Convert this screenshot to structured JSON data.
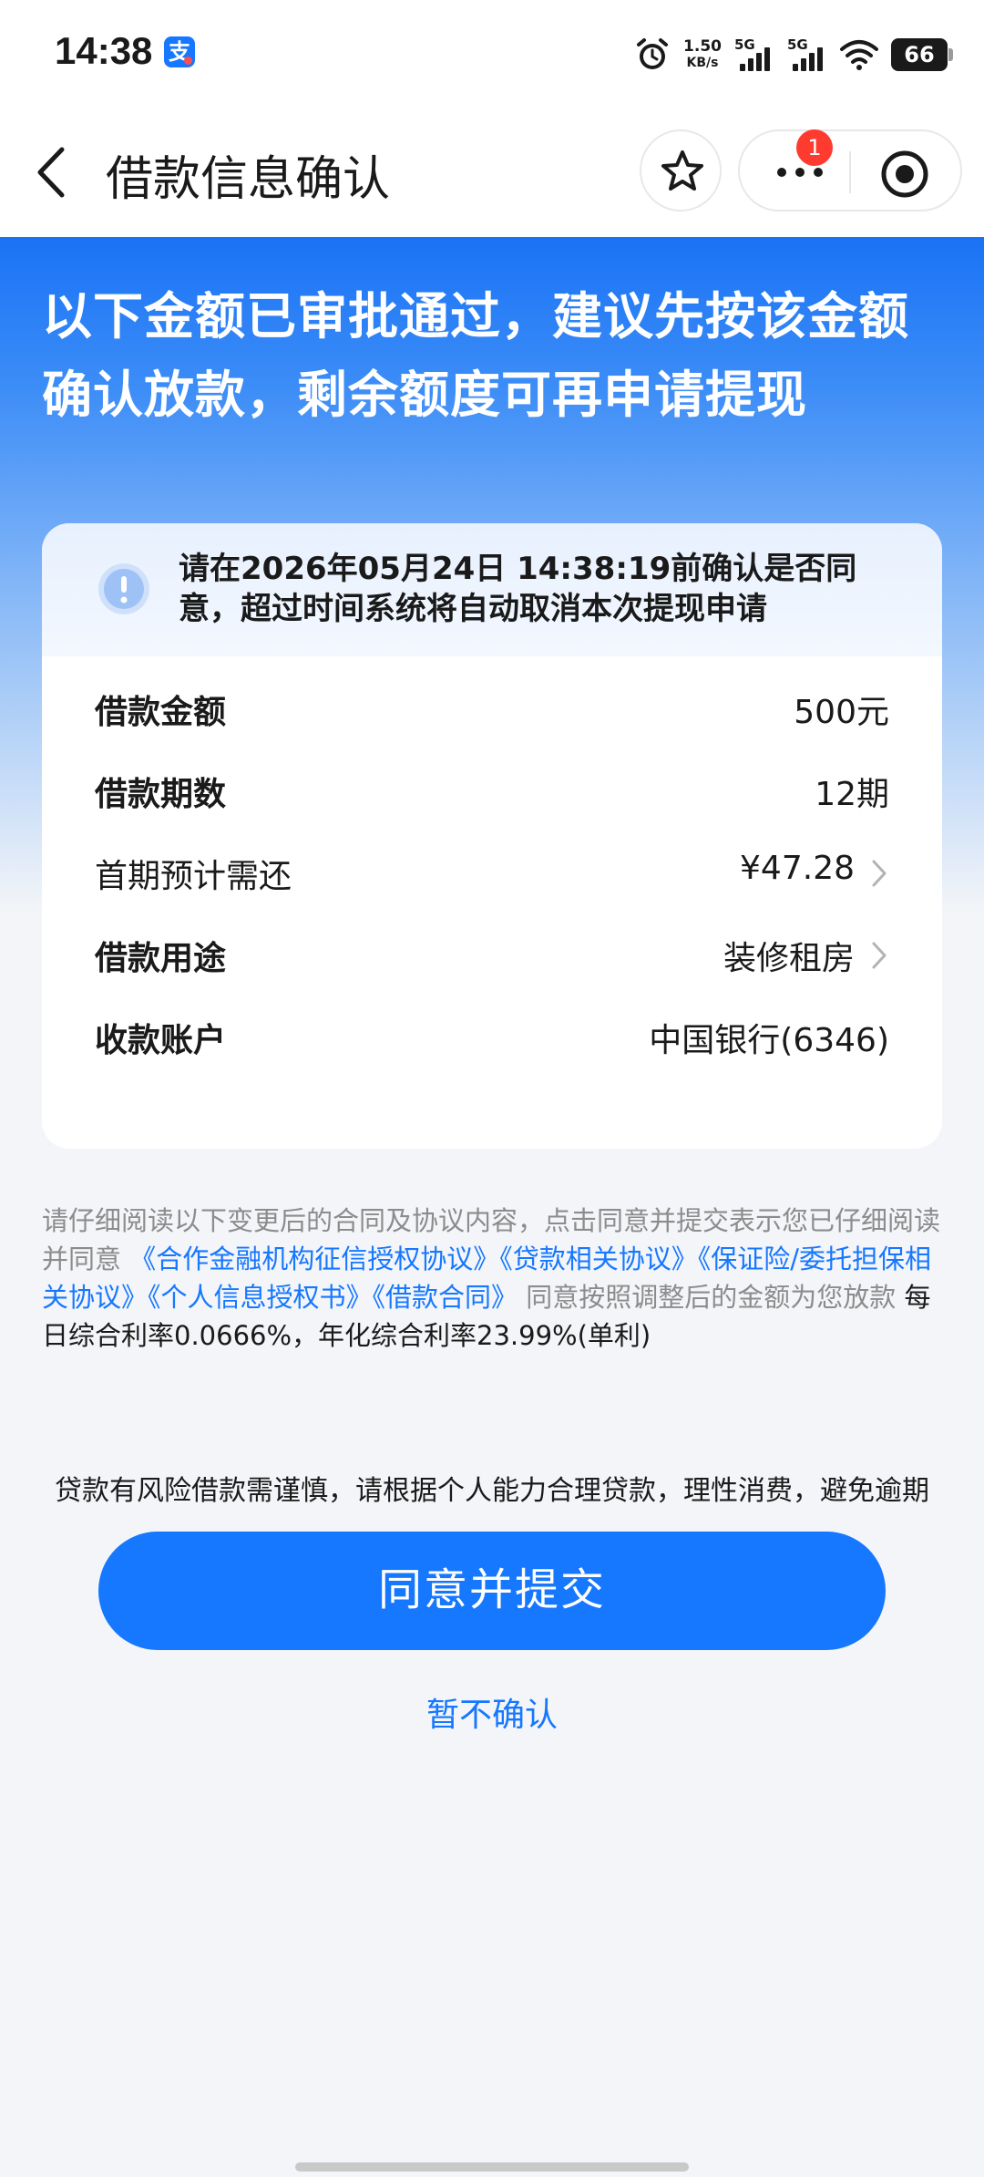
{
  "status_bar": {
    "time": "14:38",
    "app_badge": "支",
    "net_speed_value": "1.50",
    "net_speed_unit": "KB/s",
    "sim1": "5G",
    "sim2": "5G",
    "battery": "66"
  },
  "nav": {
    "title": "借款信息确认",
    "notification_count": "1"
  },
  "hero": {
    "title": "以下金额已审批通过，建议先按该金额确认放款，剩余额度可再申请提现"
  },
  "notice": {
    "text": "请在2026年05月24日 14:38:19前确认是否同意，超过时间系统将自动取消本次提现申请"
  },
  "loan_details": [
    {
      "label": "借款金额",
      "value": "500元"
    },
    {
      "label": "借款期数",
      "value": "12期"
    },
    {
      "label": "首期预计需还",
      "value": "¥47.28"
    },
    {
      "label": "借款用途",
      "value": "装修租房"
    },
    {
      "label": "收款账户",
      "value": "中国银行(6346)"
    }
  ],
  "agreement": {
    "prefix": "请仔细阅读以下变更后的合同及协议内容，点击同意并提交表示您已仔细阅读并同意",
    "links": [
      "《合作金融机构征信授权协议》",
      "《贷款相关协议》",
      "《保证险/委托担保相关协议》",
      "《个人信息授权书》",
      "《借款合同》"
    ],
    "middle": "同意按照调整后的金额为您放款",
    "rate_text": "每日综合利率0.0666%，年化综合利率23.99%(单利)"
  },
  "risk_tip": "贷款有风险借款需谨慎，请根据个人能力合理贷款，理性消费，避免逾期",
  "actions": {
    "submit_label": "同意并提交",
    "cancel_label": "暂不确认"
  },
  "colors": {
    "primary": "#1677ff",
    "hero_top": "#1a73f5",
    "badge_red": "#ff3b30"
  }
}
